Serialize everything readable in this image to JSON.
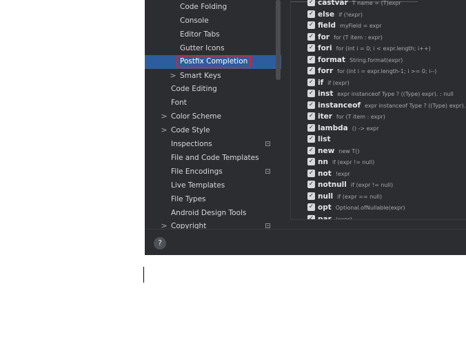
{
  "sidebar": {
    "items": [
      {
        "label": "Code Folding",
        "indent": 2,
        "chevron": false,
        "badge": false,
        "selected": false
      },
      {
        "label": "Console",
        "indent": 2,
        "chevron": false,
        "badge": false,
        "selected": false
      },
      {
        "label": "Editor Tabs",
        "indent": 2,
        "chevron": false,
        "badge": false,
        "selected": false
      },
      {
        "label": "Gutter Icons",
        "indent": 2,
        "chevron": false,
        "badge": false,
        "selected": false
      },
      {
        "label": "Postfix Completion",
        "indent": 2,
        "chevron": false,
        "badge": false,
        "selected": true
      },
      {
        "label": "Smart Keys",
        "indent": 2,
        "chevron": true,
        "badge": false,
        "selected": false
      },
      {
        "label": "Code Editing",
        "indent": 1,
        "chevron": false,
        "badge": false,
        "selected": false
      },
      {
        "label": "Font",
        "indent": 1,
        "chevron": false,
        "badge": false,
        "selected": false
      },
      {
        "label": "Color Scheme",
        "indent": 1,
        "chevron": true,
        "badge": false,
        "selected": false
      },
      {
        "label": "Code Style",
        "indent": 1,
        "chevron": true,
        "badge": false,
        "selected": false
      },
      {
        "label": "Inspections",
        "indent": 1,
        "chevron": false,
        "badge": true,
        "selected": false
      },
      {
        "label": "File and Code Templates",
        "indent": 1,
        "chevron": false,
        "badge": false,
        "selected": false
      },
      {
        "label": "File Encodings",
        "indent": 1,
        "chevron": false,
        "badge": true,
        "selected": false
      },
      {
        "label": "Live Templates",
        "indent": 1,
        "chevron": false,
        "badge": false,
        "selected": false
      },
      {
        "label": "File Types",
        "indent": 1,
        "chevron": false,
        "badge": false,
        "selected": false
      },
      {
        "label": "Android Design Tools",
        "indent": 1,
        "chevron": false,
        "badge": false,
        "selected": false
      },
      {
        "label": "Copyright",
        "indent": 1,
        "chevron": true,
        "badge": true,
        "selected": false
      }
    ],
    "chevron_glyph": ">"
  },
  "templates": [
    {
      "key": "castvar",
      "example": "T name = (T)expr",
      "checked": true
    },
    {
      "key": "else",
      "example": "if (!expr)",
      "checked": true
    },
    {
      "key": "field",
      "example": "myField = expr",
      "checked": true
    },
    {
      "key": "for",
      "example": "for (T item : expr)",
      "checked": true
    },
    {
      "key": "fori",
      "example": "for (int i = 0; i < expr.length; i++)",
      "checked": true
    },
    {
      "key": "format",
      "example": "String.format(expr)",
      "checked": true
    },
    {
      "key": "forr",
      "example": "for (int i = expr.length-1; i >= 0; i--)",
      "checked": true
    },
    {
      "key": "if",
      "example": "if (expr)",
      "checked": true
    },
    {
      "key": "inst",
      "example": "expr instanceof Type ? ((Type) expr). : null",
      "checked": true
    },
    {
      "key": "instanceof",
      "example": "expr instanceof Type ? ((Type) expr).",
      "checked": true
    },
    {
      "key": "iter",
      "example": "for (T item : expr)",
      "checked": true
    },
    {
      "key": "lambda",
      "example": "() -> expr",
      "checked": true
    },
    {
      "key": "list",
      "example": "",
      "checked": true
    },
    {
      "key": "new",
      "example": "new T()",
      "checked": true
    },
    {
      "key": "nn",
      "example": "if (expr != null)",
      "checked": true
    },
    {
      "key": "not",
      "example": "!expr",
      "checked": true
    },
    {
      "key": "notnull",
      "example": "if (expr != null)",
      "checked": true
    },
    {
      "key": "null",
      "example": "if (expr == null)",
      "checked": true
    },
    {
      "key": "opt",
      "example": "Optional.ofNullable(expr)",
      "checked": true
    },
    {
      "key": "par",
      "example": "(expr)",
      "checked": true
    }
  ],
  "checkbox_glyph": "✓",
  "help": {
    "label": "?"
  },
  "colors": {
    "background": "#2b2d30",
    "selection": "#2e5d9f",
    "highlight_border": "#e0202a"
  }
}
